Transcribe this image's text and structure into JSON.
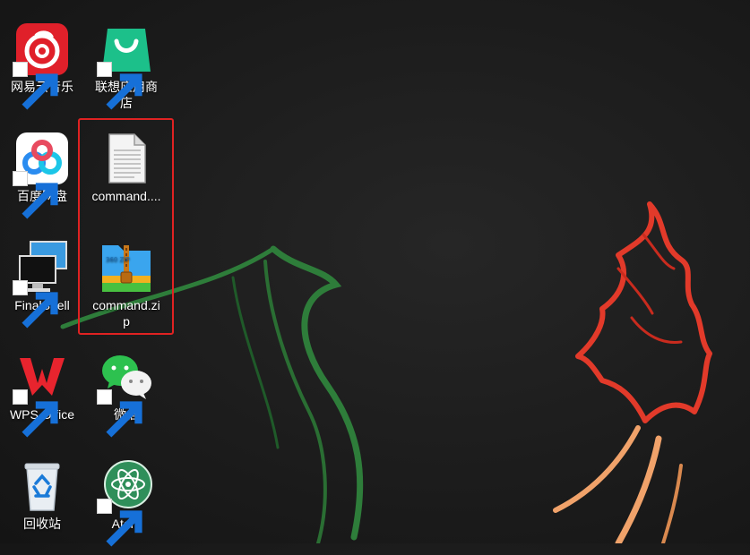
{
  "desktop": {
    "icons": [
      {
        "label": "网易云音乐",
        "icon": "netease-music-icon",
        "shortcut": true
      },
      {
        "label": "联想应用商店",
        "icon": "lenovo-app-store-icon",
        "shortcut": true
      },
      {
        "label": "百度网盘",
        "icon": "baidu-netdisk-icon",
        "shortcut": true
      },
      {
        "label": "command....",
        "icon": "text-file-icon",
        "shortcut": false
      },
      {
        "label": "FinalShell",
        "icon": "finalshell-icon",
        "shortcut": true
      },
      {
        "label": "command.zip",
        "icon": "zip-archive-icon",
        "shortcut": false
      },
      {
        "label": "WPS Office",
        "icon": "wps-office-icon",
        "shortcut": true
      },
      {
        "label": "微信",
        "icon": "wechat-icon",
        "shortcut": true
      },
      {
        "label": "回收站",
        "icon": "recycle-bin-icon",
        "shortcut": false
      },
      {
        "label": "Atom",
        "icon": "atom-editor-icon",
        "shortcut": true
      }
    ],
    "zip_icon_text": "360 ZIP",
    "selection_color": "#e02222"
  }
}
